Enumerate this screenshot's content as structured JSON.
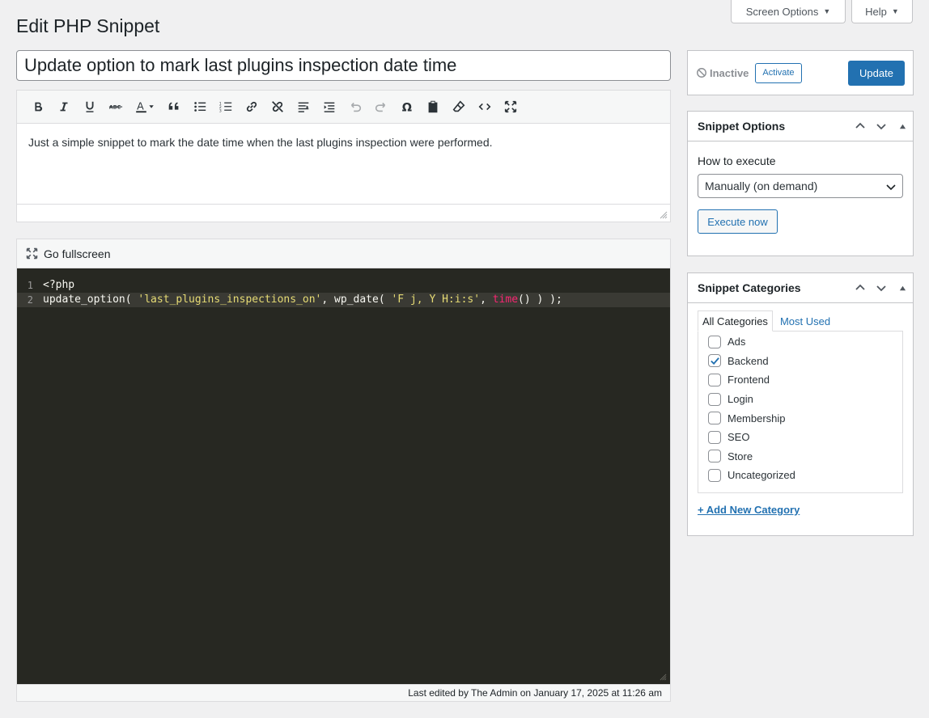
{
  "header": {
    "title": "Edit PHP Snippet",
    "screen_options": "Screen Options",
    "help": "Help"
  },
  "snippet": {
    "name": "Update option to mark last plugins inspection date time",
    "description": "Just a simple snippet to mark the date time when the last plugins inspection were performed."
  },
  "toolbar": {
    "buttons": [
      "bold-icon",
      "italic-icon",
      "underline-icon",
      "strikethrough-icon",
      "text-color-icon",
      "blockquote-icon",
      "bullet-list-icon",
      "numbered-list-icon",
      "link-icon",
      "unlink-icon",
      "align-icon",
      "indent-icon",
      "undo-icon",
      "redo-icon",
      "omega-icon",
      "paste-icon",
      "clear-format-icon",
      "code-icon",
      "fullscreen-icon"
    ]
  },
  "code_editor": {
    "fullscreen_label": "Go fullscreen",
    "lines": [
      {
        "num": "1",
        "text": "<?php"
      },
      {
        "num": "2",
        "text": "update_option( 'last_plugins_inspections_on', wp_date( 'F j, Y H:i:s', time() ) );"
      }
    ],
    "tokens": {
      "line2_a": "update_option( ",
      "line2_b": "'last_plugins_inspections_on'",
      "line2_c": ", wp_date( ",
      "line2_d": "'F j, Y H:i:s'",
      "line2_e": ", ",
      "line2_f": "time",
      "line2_g": "() ) );"
    },
    "last_edited": "Last edited by The Admin on January 17, 2025 at 11:26 am"
  },
  "publish": {
    "status": "Inactive",
    "activate": "Activate",
    "update": "Update"
  },
  "options_box": {
    "title": "Snippet Options",
    "how_label": "How to execute",
    "execute_value": "Manually (on demand)",
    "execute_now": "Execute now"
  },
  "categories_box": {
    "title": "Snippet Categories",
    "tab_all": "All Categories",
    "tab_used": "Most Used",
    "items": [
      {
        "label": "Ads",
        "checked": false
      },
      {
        "label": "Backend",
        "checked": true
      },
      {
        "label": "Frontend",
        "checked": false
      },
      {
        "label": "Login",
        "checked": false
      },
      {
        "label": "Membership",
        "checked": false
      },
      {
        "label": "SEO",
        "checked": false
      },
      {
        "label": "Store",
        "checked": false
      },
      {
        "label": "Uncategorized",
        "checked": false
      }
    ],
    "add_new": "+ Add New Category"
  },
  "colors": {
    "accent": "#2271b1",
    "code_bg": "#272822",
    "code_string": "#e6db74",
    "code_builtin": "#f92672"
  }
}
